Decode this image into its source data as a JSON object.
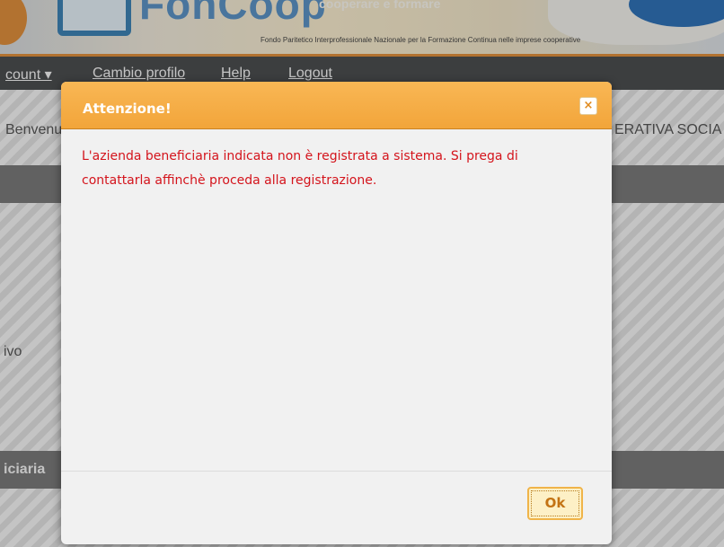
{
  "header": {
    "brand": "FonCoop",
    "brand_sub": "cooperare e formare",
    "tagline": "Fondo Paritetico Interprofessionale Nazionale per la Formazione Continua nelle imprese cooperative"
  },
  "nav": {
    "account": "count ▾",
    "profile": "Cambio profilo",
    "help": "Help",
    "logout": "Logout"
  },
  "background": {
    "welcome": "Benvenu",
    "org": "ERATIVA SOCIA",
    "field": "ivo",
    "section": "iciaria"
  },
  "dialog": {
    "title": "Attenzione!",
    "close_glyph": "×",
    "message": "L'azienda beneficiaria indicata non è registrata a sistema. Si prega di contattarla affinchè proceda alla registrazione.",
    "ok_label": "Ok"
  },
  "colors": {
    "titlebar": "#f2a53a",
    "message": "#d4141c",
    "nav": "#4a4c4e"
  }
}
